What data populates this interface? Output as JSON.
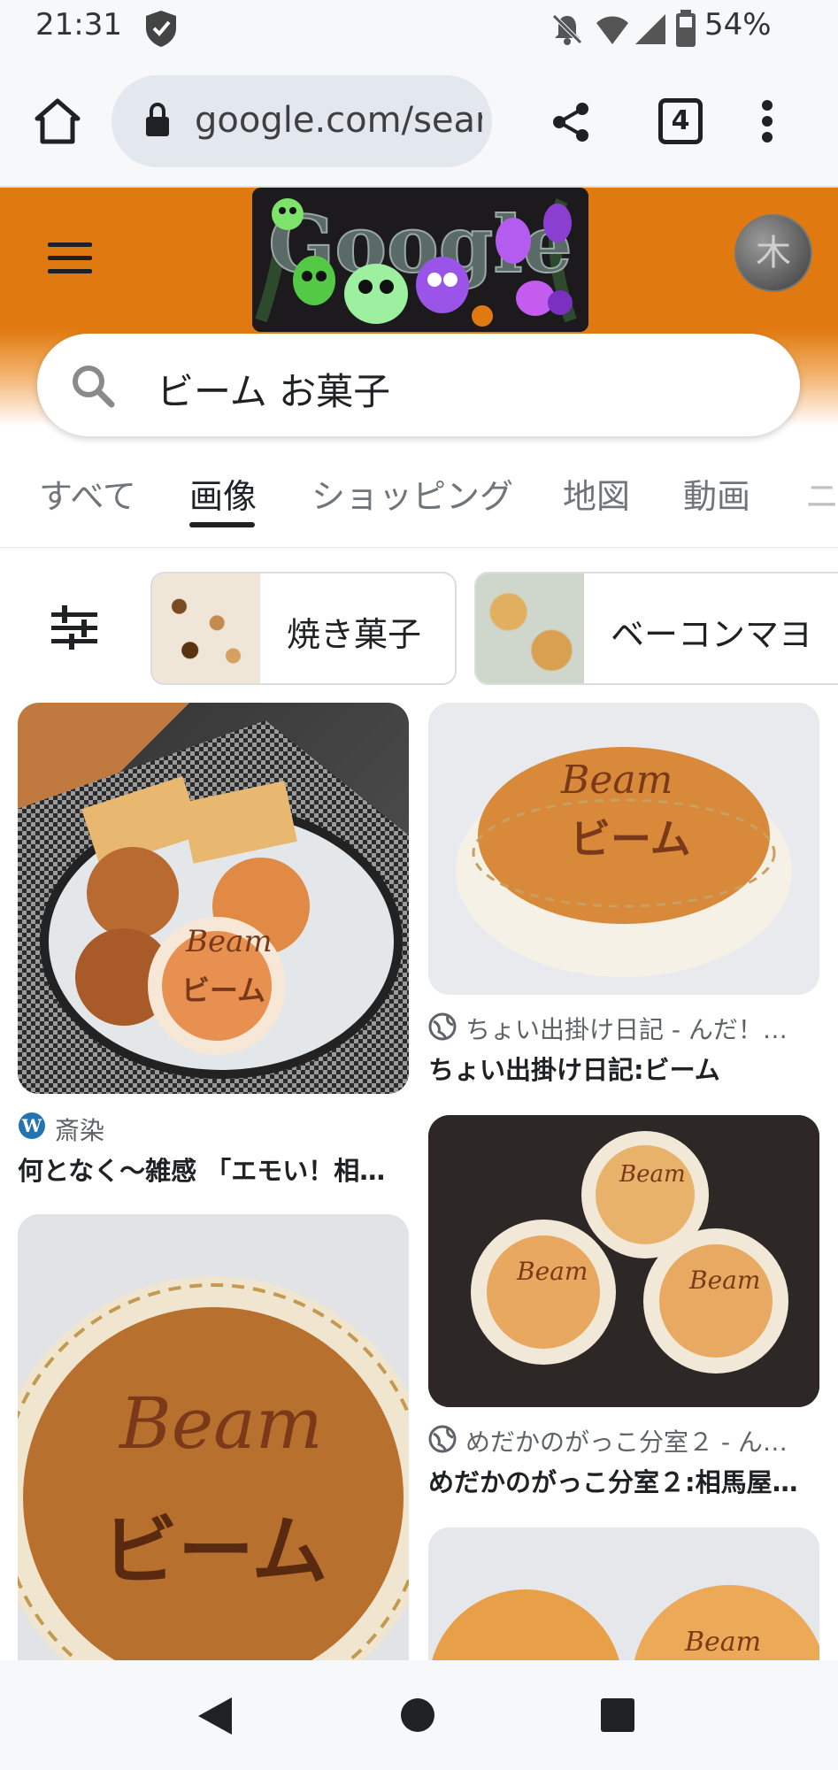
{
  "status_bar": {
    "time": "21:31",
    "battery": "54%"
  },
  "browser": {
    "url": "google.com/sear",
    "tab_count": "4"
  },
  "search": {
    "query": "ビーム お菓子"
  },
  "tabs": [
    {
      "label": "すべて"
    },
    {
      "label": "画像"
    },
    {
      "label": "ショッピング"
    },
    {
      "label": "地図"
    },
    {
      "label": "動画"
    }
  ],
  "chips": [
    {
      "label": "焼き菓子"
    },
    {
      "label": "ベーコンマヨ"
    }
  ],
  "results": [
    {
      "source": "斎染",
      "title": "何となく～雑感 「エモい！相…"
    },
    {
      "source": "ちょい出掛け日記 - んだ！…",
      "title": "ちょい出掛け日記:ビーム"
    },
    {
      "source": "めだかのがっこ分室２ - ん…",
      "title": "めだかのがっこ分室２:相馬屋…"
    },
    {
      "source": "",
      "title": ""
    },
    {
      "source": "",
      "title": ""
    }
  ],
  "image_texts": {
    "beam_en": "Beam",
    "beam_ja": "ビーム"
  },
  "colors": {
    "header_orange": "#e07a10",
    "accent": "#202124"
  }
}
